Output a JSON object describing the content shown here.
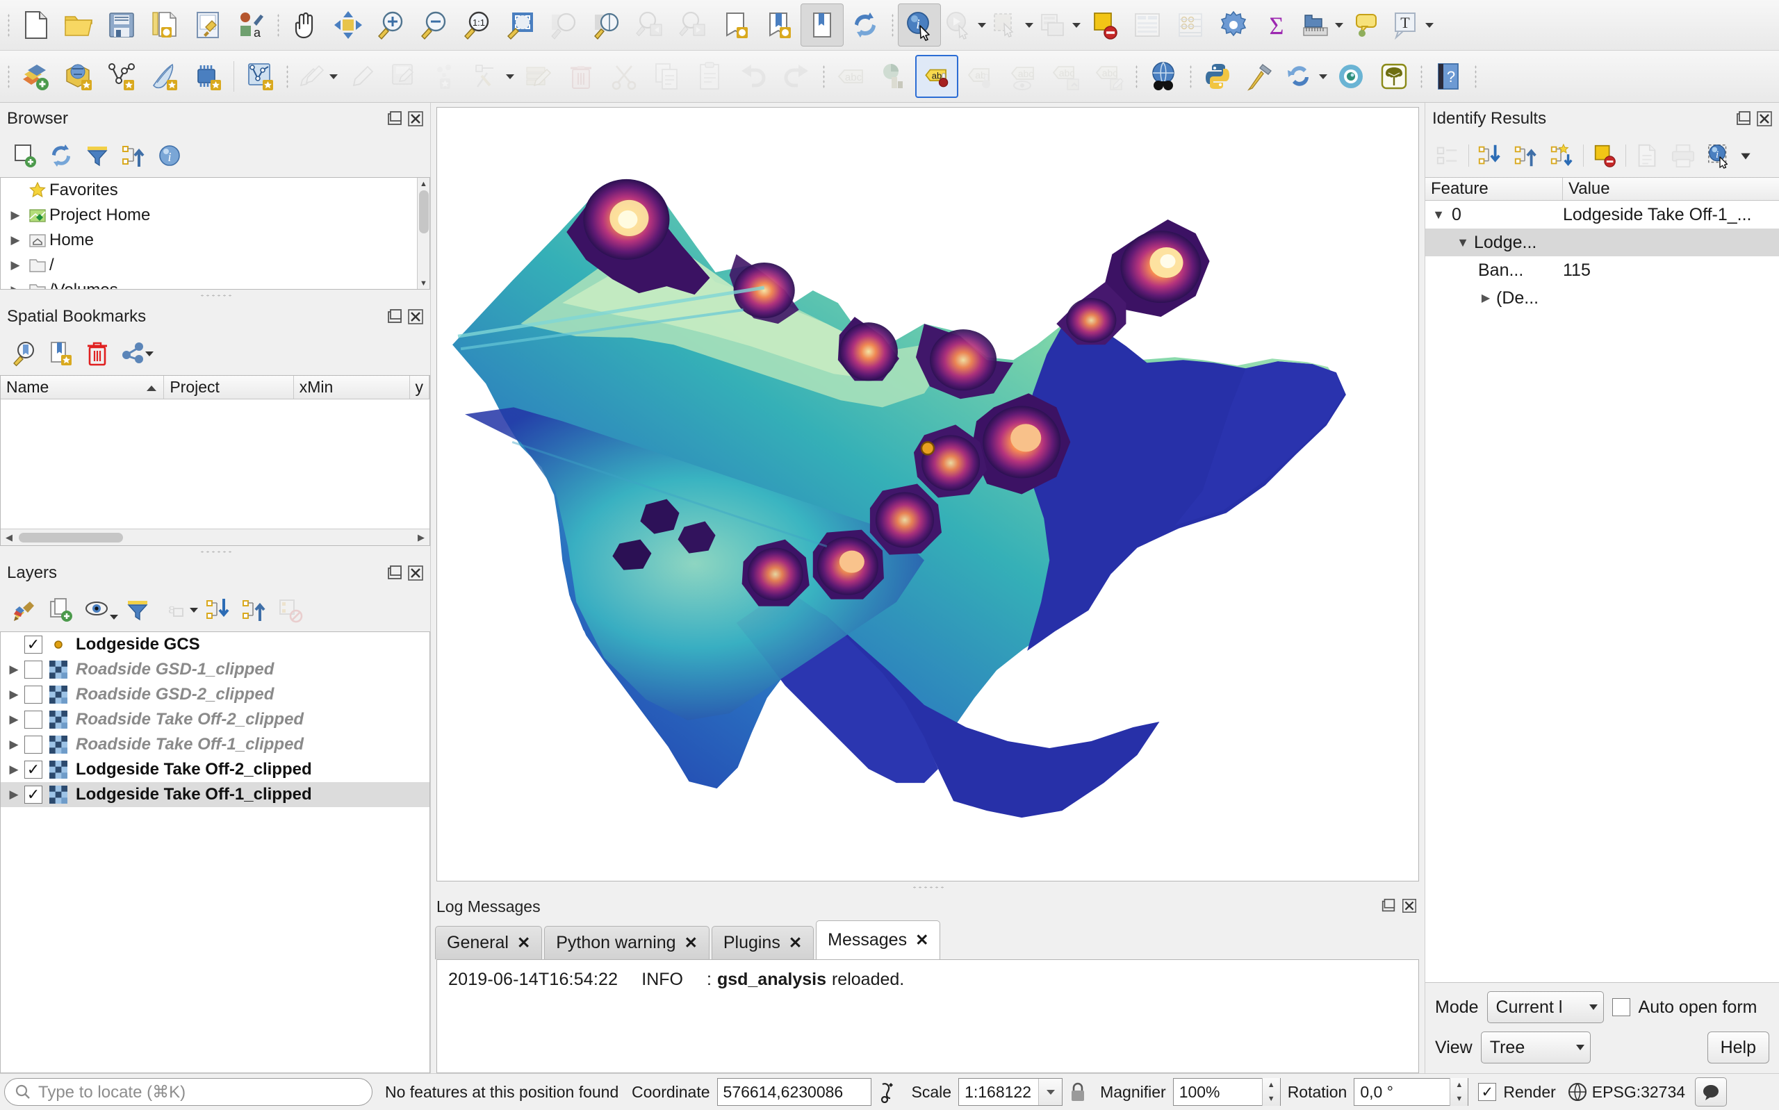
{
  "toolbars": {
    "row1": [
      {
        "name": "new-project-icon",
        "label": "New Project"
      },
      {
        "name": "open-project-icon",
        "label": "Open Project"
      },
      {
        "name": "save-project-icon",
        "label": "Save Project"
      },
      {
        "name": "new-print-layout-icon",
        "label": "New Print Layout"
      },
      {
        "name": "style-manager-icon",
        "label": "Style Manager"
      },
      {
        "name": "new-map-view-icon",
        "label": "New Map View"
      },
      {
        "name": "pan-map-icon",
        "label": "Pan Map"
      },
      {
        "name": "pan-to-selection-icon",
        "label": "Pan Map to Selection"
      },
      {
        "name": "zoom-in-icon",
        "label": "Zoom In"
      },
      {
        "name": "zoom-out-icon",
        "label": "Zoom Out"
      },
      {
        "name": "zoom-native-icon",
        "label": "Zoom to Native Resolution"
      },
      {
        "name": "zoom-full-icon",
        "label": "Zoom Full"
      },
      {
        "name": "zoom-selection-icon",
        "label": "Zoom to Selection"
      },
      {
        "name": "zoom-layer-icon",
        "label": "Zoom to Layer"
      },
      {
        "name": "zoom-last-icon",
        "label": "Zoom Last"
      },
      {
        "name": "zoom-next-icon",
        "label": "Zoom Next"
      },
      {
        "name": "new-map-bookmark-icon",
        "label": "New Map Bookmark"
      },
      {
        "name": "show-bookmarks-icon",
        "label": "Show Bookmarks"
      },
      {
        "name": "show-bookmark-manager-icon",
        "label": "Show Bookmark Manager"
      },
      {
        "name": "refresh-icon",
        "label": "Refresh"
      },
      {
        "name": "identify-features-icon",
        "label": "Identify Features"
      },
      {
        "name": "run-feature-action-icon",
        "label": "Run Feature Action"
      },
      {
        "name": "select-features-icon",
        "label": "Select Features by Area"
      },
      {
        "name": "select-value-icon",
        "label": "Select Features by Value"
      },
      {
        "name": "deselect-features-icon",
        "label": "Deselect Features"
      },
      {
        "name": "open-attribute-table-icon",
        "label": "Open Attribute Table"
      },
      {
        "name": "field-calculator-icon",
        "label": "Open Field Calculator"
      },
      {
        "name": "options-icon",
        "label": "Options"
      },
      {
        "name": "statistical-summary-icon",
        "label": "Show Statistical Summary"
      },
      {
        "name": "measure-line-icon",
        "label": "Measure Line"
      },
      {
        "name": "map-tips-icon",
        "label": "Show Map Tips"
      },
      {
        "name": "text-annotation-icon",
        "label": "Text Annotation"
      }
    ],
    "row2": [
      {
        "name": "add-layer-icon",
        "label": "Open Data Source Manager"
      },
      {
        "name": "add-vector-layer-icon",
        "label": "Add Vector Layer"
      },
      {
        "name": "new-shapefile-layer-icon",
        "label": "New Shapefile Layer"
      },
      {
        "name": "new-spatialite-layer-icon",
        "label": "New SpatiaLite Layer"
      },
      {
        "name": "new-geopackage-layer-icon",
        "label": "New GeoPackage Layer"
      },
      {
        "name": "new-memory-layer-icon",
        "label": "New Temporary Scratch Layer"
      },
      {
        "name": "current-edits-icon",
        "label": "Current Edits"
      },
      {
        "name": "toggle-editing-icon",
        "label": "Toggle Editing"
      },
      {
        "name": "save-layer-edits-icon",
        "label": "Save Layer Edits"
      },
      {
        "name": "add-feature-icon",
        "label": "Add Feature"
      },
      {
        "name": "vertex-tool-icon",
        "label": "Vertex Tool"
      },
      {
        "name": "modify-attributes-icon",
        "label": "Modify Attributes of Features"
      },
      {
        "name": "delete-selected-icon",
        "label": "Delete Selected"
      },
      {
        "name": "cut-features-icon",
        "label": "Cut Features"
      },
      {
        "name": "copy-features-icon",
        "label": "Copy Features"
      },
      {
        "name": "paste-features-icon",
        "label": "Paste Features"
      },
      {
        "name": "undo-icon",
        "label": "Undo"
      },
      {
        "name": "redo-icon",
        "label": "Redo"
      },
      {
        "name": "label-layer-icon",
        "label": "Layer Labeling Options"
      },
      {
        "name": "diagram-icon",
        "label": "Layer Diagram Options"
      },
      {
        "name": "pin-labels-icon",
        "label": "Pin/Unpin Labels"
      },
      {
        "name": "show-hide-labels-icon",
        "label": "Show/Hide Labels"
      },
      {
        "name": "move-label-icon",
        "label": "Move a Label"
      },
      {
        "name": "rotate-label-icon",
        "label": "Rotate a Label"
      },
      {
        "name": "change-label-icon",
        "label": "Change Label"
      },
      {
        "name": "metasearch-icon",
        "label": "MetaSearch"
      },
      {
        "name": "python-console-icon",
        "label": "Python Console"
      },
      {
        "name": "plugin-manager-icon",
        "label": "Plugin Manager"
      },
      {
        "name": "plugin-reloader-icon",
        "label": "Plugin Reloader"
      },
      {
        "name": "gsd-analysis-icon",
        "label": "GSD Analysis"
      },
      {
        "name": "tree-plugin-icon",
        "label": "Tree Plugin"
      },
      {
        "name": "help-icon",
        "label": "Help"
      }
    ]
  },
  "browser": {
    "title": "Browser",
    "toolbar": [
      {
        "name": "add-selected-layers-icon",
        "label": "Add Selected Layers"
      },
      {
        "name": "refresh-browser-icon",
        "label": "Refresh"
      },
      {
        "name": "filter-browser-icon",
        "label": "Filter Browser"
      },
      {
        "name": "collapse-all-icon",
        "label": "Collapse All"
      },
      {
        "name": "enable-properties-icon",
        "label": "Enable/Disable Properties Widget"
      }
    ],
    "items": [
      {
        "label": "Favorites",
        "icon": "star-icon",
        "expandable": false
      },
      {
        "label": "Project Home",
        "icon": "project-home-icon",
        "expandable": true
      },
      {
        "label": "Home",
        "icon": "home-folder-icon",
        "expandable": true
      },
      {
        "label": "/",
        "icon": "folder-icon",
        "expandable": true
      },
      {
        "label": "/Volumes",
        "icon": "folder-icon",
        "expandable": true
      }
    ]
  },
  "bookmarks": {
    "title": "Spatial Bookmarks",
    "toolbar": [
      {
        "name": "zoom-to-bookmark-icon",
        "label": "Zoom to Bookmark"
      },
      {
        "name": "add-bookmark-icon",
        "label": "Add Bookmark"
      },
      {
        "name": "delete-bookmark-icon",
        "label": "Delete Bookmark"
      },
      {
        "name": "import-export-bookmarks-icon",
        "label": "Import/Export Bookmarks"
      }
    ],
    "columns": [
      "Name",
      "Project",
      "xMin",
      "y"
    ],
    "rows": []
  },
  "layers": {
    "title": "Layers",
    "toolbar": [
      {
        "name": "open-layer-styling-icon",
        "label": "Open the Layer Styling panel"
      },
      {
        "name": "add-group-icon",
        "label": "Add Group"
      },
      {
        "name": "manage-visibility-icon",
        "label": "Manage Map Themes"
      },
      {
        "name": "filter-legend-icon",
        "label": "Filter Legend"
      },
      {
        "name": "expression-filter-icon",
        "label": "Filter Legend by Expression"
      },
      {
        "name": "expand-all-icon",
        "label": "Expand All"
      },
      {
        "name": "collapse-all-layers-icon",
        "label": "Collapse All"
      },
      {
        "name": "remove-layer-icon",
        "label": "Remove Layer/Group"
      }
    ],
    "items": [
      {
        "label": "Lodgeside GCS",
        "checked": true,
        "type": "point",
        "style": "bold",
        "expandable": false,
        "selected": false
      },
      {
        "label": "Roadside GSD-1_clipped",
        "checked": false,
        "type": "raster",
        "style": "italic",
        "expandable": true,
        "selected": false
      },
      {
        "label": "Roadside GSD-2_clipped",
        "checked": false,
        "type": "raster",
        "style": "italic",
        "expandable": true,
        "selected": false
      },
      {
        "label": "Roadside Take Off-2_clipped",
        "checked": false,
        "type": "raster",
        "style": "italic",
        "expandable": true,
        "selected": false
      },
      {
        "label": "Roadside Take Off-1_clipped",
        "checked": false,
        "type": "raster",
        "style": "italic",
        "expandable": true,
        "selected": false
      },
      {
        "label": "Lodgeside Take Off-2_clipped",
        "checked": true,
        "type": "raster",
        "style": "bold",
        "expandable": true,
        "selected": false
      },
      {
        "label": "Lodgeside Take Off-1_clipped",
        "checked": true,
        "type": "raster",
        "style": "bold",
        "expandable": true,
        "selected": true
      }
    ]
  },
  "identify": {
    "title": "Identify Results",
    "toolbar": [
      {
        "name": "expand-new-icon",
        "label": "Expand New Results"
      },
      {
        "name": "expand-all-results-icon",
        "label": "Expand All"
      },
      {
        "name": "collapse-all-results-icon",
        "label": "Collapse All"
      },
      {
        "name": "default-actions-icon",
        "label": "Default Actions"
      },
      {
        "name": "clear-results-icon",
        "label": "Clear Results"
      },
      {
        "name": "copy-results-icon",
        "label": "Copy Selected Feature To Clipboard"
      },
      {
        "name": "print-results-icon",
        "label": "Print"
      },
      {
        "name": "identify-settings-icon",
        "label": "Identify Settings"
      }
    ],
    "columns": [
      "Feature",
      "Value"
    ],
    "rows": [
      {
        "indent": 0,
        "arrow": "down",
        "feature": "0",
        "value": "Lodgeside Take Off-1_...",
        "alt": false
      },
      {
        "indent": 1,
        "arrow": "down",
        "feature": "Lodge...",
        "value": "",
        "alt": true
      },
      {
        "indent": 2,
        "arrow": "none",
        "feature": "Ban...",
        "value": "115",
        "alt": false
      },
      {
        "indent": 2,
        "arrow": "right",
        "feature": "(De...",
        "value": "",
        "alt": false
      }
    ],
    "mode_label": "Mode",
    "mode_value": "Current l",
    "auto_open_form_label": "Auto open form",
    "auto_open_form_checked": false,
    "view_label": "View",
    "view_value": "Tree",
    "help_label": "Help"
  },
  "log": {
    "title": "Log Messages",
    "tabs": [
      {
        "label": "General",
        "active": false
      },
      {
        "label": "Python warning",
        "active": false
      },
      {
        "label": "Plugins",
        "active": false
      },
      {
        "label": "Messages",
        "active": true
      }
    ],
    "entry": {
      "timestamp": "2019-06-14T16:54:22",
      "level": "INFO",
      "separator": ":",
      "source": "gsd_analysis",
      "message": "reloaded."
    }
  },
  "status": {
    "locate_placeholder": "Type to locate (⌘K)",
    "message": "No features at this position found",
    "coordinate_label": "Coordinate",
    "coordinate_value": "576614,6230086",
    "scale_label": "Scale",
    "scale_value": "1:168122",
    "magnifier_label": "Magnifier",
    "magnifier_value": "100%",
    "rotation_label": "Rotation",
    "rotation_value": "0,0 °",
    "render_label": "Render",
    "render_checked": true,
    "crs_value": "EPSG:32734"
  },
  "colors": {
    "accent": "#3b6ea5",
    "panel_bg": "#f0f0f0",
    "selection": "#dcdcdc",
    "raster_hot": "#fde18a",
    "raster_cool": "#2b2bab"
  }
}
